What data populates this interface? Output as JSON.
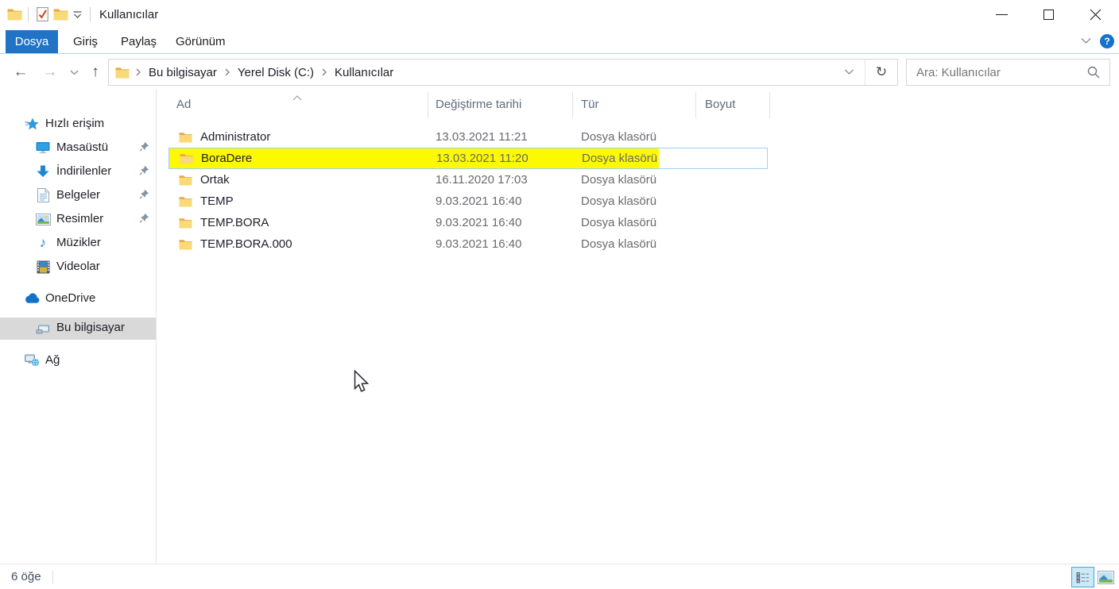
{
  "titlebar": {
    "title": "Kullanıcılar"
  },
  "ribbon": {
    "tabs": [
      {
        "label": "Dosya",
        "active": true
      },
      {
        "label": "Giriş",
        "active": false
      },
      {
        "label": "Paylaş",
        "active": false
      },
      {
        "label": "Görünüm",
        "active": false
      }
    ],
    "help_label": "?"
  },
  "addressbar": {
    "breadcrumbs": [
      "Bu bilgisayar",
      "Yerel Disk (C:)",
      "Kullanıcılar"
    ],
    "icons": {
      "back": "←",
      "forward": "→",
      "up": "↑",
      "refresh": "↻"
    }
  },
  "search": {
    "placeholder": "Ara: Kullanıcılar"
  },
  "sidebar": {
    "items": [
      {
        "label": "Hızlı erişim",
        "icon": "quick-access-star",
        "pinned": false,
        "selected": false
      },
      {
        "label": "Masaüstü",
        "icon": "desktop",
        "pinned": true,
        "selected": false
      },
      {
        "label": "İndirilenler",
        "icon": "downloads-arrow",
        "pinned": true,
        "selected": false
      },
      {
        "label": "Belgeler",
        "icon": "document",
        "pinned": true,
        "selected": false
      },
      {
        "label": "Resimler",
        "icon": "picture",
        "pinned": true,
        "selected": false
      },
      {
        "label": "Müzikler",
        "icon": "music-note",
        "pinned": false,
        "selected": false
      },
      {
        "label": "Videolar",
        "icon": "film",
        "pinned": false,
        "selected": false
      },
      {
        "label": "OneDrive",
        "icon": "cloud",
        "pinned": false,
        "selected": false
      },
      {
        "label": "Bu bilgisayar",
        "icon": "computer",
        "pinned": false,
        "selected": true
      },
      {
        "label": "Ağ",
        "icon": "network",
        "pinned": false,
        "selected": false
      }
    ],
    "music_glyph": "♪"
  },
  "filelist": {
    "columns": [
      {
        "label": "Ad",
        "sorted": "asc"
      },
      {
        "label": "Değiştirme tarihi",
        "sorted": null
      },
      {
        "label": "Tür",
        "sorted": null
      },
      {
        "label": "Boyut",
        "sorted": null
      }
    ],
    "rows": [
      {
        "name": "Administrator",
        "date": "13.03.2021 11:21",
        "type": "Dosya klasörü",
        "size": "",
        "highlighted": false,
        "selected": false
      },
      {
        "name": "BoraDere",
        "date": "13.03.2021 11:20",
        "type": "Dosya klasörü",
        "size": "",
        "highlighted": true,
        "selected": true
      },
      {
        "name": "Ortak",
        "date": "16.11.2020 17:03",
        "type": "Dosya klasörü",
        "size": "",
        "highlighted": false,
        "selected": false
      },
      {
        "name": "TEMP",
        "date": "9.03.2021 16:40",
        "type": "Dosya klasörü",
        "size": "",
        "highlighted": false,
        "selected": false
      },
      {
        "name": "TEMP.BORA",
        "date": "9.03.2021 16:40",
        "type": "Dosya klasörü",
        "size": "",
        "highlighted": false,
        "selected": false
      },
      {
        "name": "TEMP.BORA.000",
        "date": "9.03.2021 16:40",
        "type": "Dosya klasörü",
        "size": "",
        "highlighted": false,
        "selected": false
      }
    ]
  },
  "statusbar": {
    "item_count": "6 öğe"
  },
  "colors": {
    "accent_blue": "#2173c6",
    "highlight_yellow": "#fdf900",
    "selection_border": "#9ed2f2",
    "sidebar_selected_bg": "#d9d9d9",
    "folder_front": "#f9d978",
    "folder_back": "#e8a845"
  }
}
